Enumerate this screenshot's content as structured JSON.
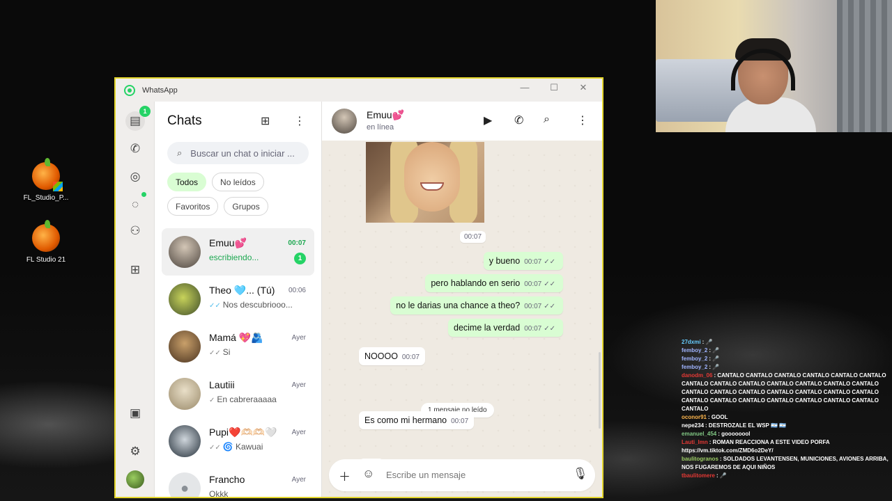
{
  "desktop": {
    "icons": [
      {
        "label": "FL_Studio_P..."
      },
      {
        "label": "FL Studio 21"
      }
    ]
  },
  "window": {
    "title": "WhatsApp",
    "minimize": "—",
    "maximize": "☐",
    "close": "✕"
  },
  "rail": {
    "chats_badge": "1"
  },
  "chatlist": {
    "title": "Chats",
    "search_placeholder": "Buscar un chat o iniciar ...",
    "filters": [
      "Todos",
      "No leídos",
      "Favoritos",
      "Grupos"
    ],
    "chats": [
      {
        "name": "Emuu💕",
        "time": "00:07",
        "preview": "escribiendo...",
        "unread": "1"
      },
      {
        "name": "Theo 🩵...  (Tú)",
        "time": "00:06",
        "preview": "Nos descubriooo..."
      },
      {
        "name": "Mamá 💖🫂",
        "time": "Ayer",
        "preview": "Si"
      },
      {
        "name": "Lautiii",
        "time": "Ayer",
        "preview": "En cabreraaaaa"
      },
      {
        "name": "Pupi❤️🫶🏻🫶🏻🤍",
        "time": "Ayer",
        "preview": "🌀 Kawuai"
      },
      {
        "name": "Francho",
        "time": "Ayer",
        "preview": "Okkk"
      }
    ]
  },
  "conversation": {
    "contact": "Emuu💕",
    "status": "en línea",
    "photo_time": "00:07",
    "messages": [
      {
        "dir": "out",
        "text": "y bueno",
        "time": "00:07"
      },
      {
        "dir": "out",
        "text": "pero hablando en serio",
        "time": "00:07"
      },
      {
        "dir": "out",
        "text": "no le darias una chance a theo?",
        "time": "00:07"
      },
      {
        "dir": "out",
        "text": "decime la verdad",
        "time": "00:07"
      },
      {
        "dir": "in",
        "text": "NOOOO",
        "time": "00:07"
      },
      {
        "dir": "in",
        "text": "Es como mi hermano",
        "time": "00:07"
      }
    ],
    "unread_divider": "1 mensaje no leído",
    "typing": "•••",
    "composer_placeholder": "Escribe un mensaje"
  },
  "stream_chat": {
    "messages": [
      {
        "user": "27dxmi",
        "text": ": 🎤",
        "color": "#66ccff"
      },
      {
        "user": "femboy_2",
        "text": ": 🎤",
        "color": "#a0b4ff"
      },
      {
        "user": "femboy_2",
        "text": ": 🎤",
        "color": "#a0b4ff"
      },
      {
        "user": "femboy_2",
        "text": ": 🎤",
        "color": "#a0b4ff"
      },
      {
        "user": "danodm_06",
        "text": ": CANTALO CANTALO CANTALO CANTALO CANTALO CANTALO CANTALO CANTALO CANTALO CANTALO CANTALO CANTALO CANTALO CANTALO CANTALO CANTALO CANTALO CANTALO CANTALO CANTALO CANTALO CANTALO CANTALO CANTALO CANTALO CANTALO CANTALO CANTALO",
        "color": "#e53935"
      },
      {
        "user": "oconor91",
        "text": ": GOOL",
        "color": "#ffb74d"
      },
      {
        "user": "nepe234",
        "text": ": DESTROZALE EL WSP 🇦🇷 🇦🇷",
        "color": "#ffffff"
      },
      {
        "user": "emanuel_454",
        "text": ": goooooool",
        "color": "#81c784"
      },
      {
        "user": "Lauti_lmn",
        "text": ": ROMAN REACCIONA A ESTE VIDEO PORFA https://vm.tiktok.com/ZMD6o2DeY/",
        "color": "#e53935"
      },
      {
        "user": "baulitogranos",
        "text": ": SOLDADOS LEVANTENSEN, MUNICIONES, AVIONES ARRIBA, NOS FUGAREMOS DE AQUI NIÑOS",
        "color": "#9ccc65"
      },
      {
        "user": "tbaulitomere",
        "text": ": 🎤",
        "color": "#e53935"
      }
    ]
  }
}
